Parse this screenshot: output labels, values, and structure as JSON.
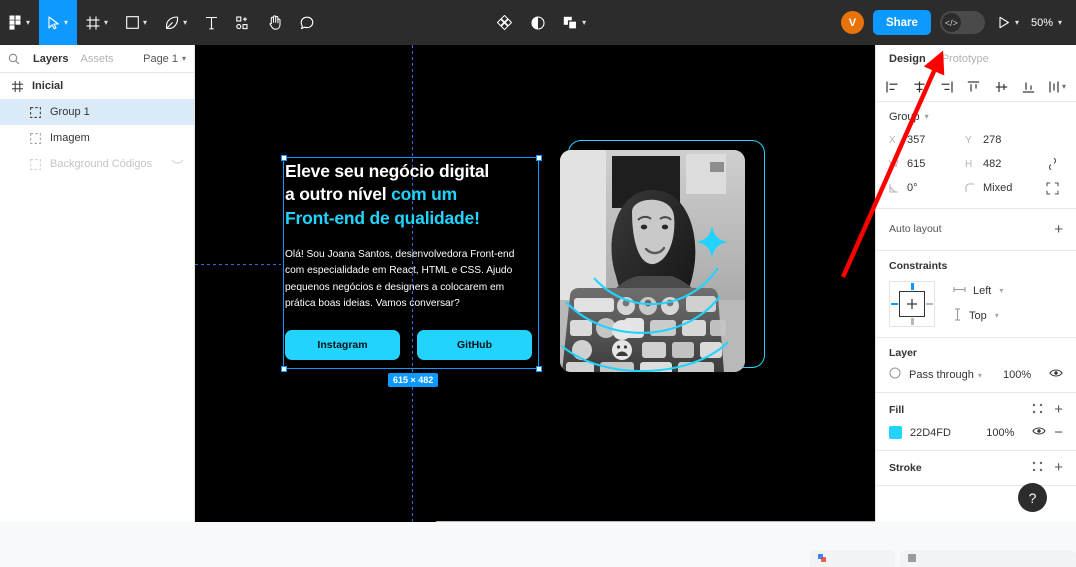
{
  "toolbar": {
    "menu_icon": "figma-logo-icon",
    "move_tool": "move-cursor-icon",
    "frame_tool": "frame-icon",
    "shape_tool": "rectangle-icon",
    "pen_tool": "pen-icon",
    "text_tool": "text-icon",
    "components_tool": "components-plus-icon",
    "hand_tool": "hand-icon",
    "comment_tool": "comment-bubble-icon",
    "plugin_icon": "plugin-diamond-icon",
    "contrast_icon": "contrast-half-circle-icon",
    "boolean_icon": "boolean-union-icon",
    "avatar_initial": "V",
    "share_label": "Share",
    "dev_mode_icon": "code-slash-icon",
    "present_icon": "play-triangle-icon",
    "zoom_level": "50%"
  },
  "left_panel": {
    "search_icon": "search-icon",
    "tabs": [
      {
        "label": "Layers",
        "active": true
      },
      {
        "label": "Assets",
        "active": false
      }
    ],
    "page_selector": "Page 1",
    "layers": [
      {
        "name": "Inicial",
        "icon": "frame-icon",
        "depth": 0,
        "selected": false,
        "dimmed": false,
        "hidden": false
      },
      {
        "name": "Group 1",
        "icon": "group-icon",
        "depth": 1,
        "selected": true,
        "dimmed": false,
        "hidden": false
      },
      {
        "name": "Imagem",
        "icon": "group-icon",
        "depth": 1,
        "selected": false,
        "dimmed": false,
        "hidden": false
      },
      {
        "name": "Background Códigos",
        "icon": "group-icon",
        "depth": 1,
        "selected": false,
        "dimmed": true,
        "hidden": true
      }
    ]
  },
  "canvas": {
    "background_color": "#000000",
    "accent_color": "#22D4FD",
    "selection_color": "#0D99FF",
    "size_badge": "615 × 482",
    "design": {
      "heading_line1": "Eleve seu negócio digital",
      "heading_line2_plain": "a outro nível ",
      "heading_line2_accent": "com um",
      "heading_line3_accent": "Front-end de qualidade!",
      "body": "Olá! Sou Joana Santos, desenvolvedora Front-end com especialidade em React, HTML e CSS. Ajudo pequenos negócios e designers a colocarem em prática boas ideias. Vamos conversar?",
      "buttons": [
        {
          "label": "Instagram"
        },
        {
          "label": "GitHub"
        }
      ],
      "photo_alt": "black-and-white photo of a woman smiling at a sticker-covered laptop"
    }
  },
  "right_panel": {
    "tabs": [
      {
        "label": "Design",
        "active": true
      },
      {
        "label": "Prototype",
        "active": false
      }
    ],
    "align_icons": [
      "align-left-icon",
      "align-horizontal-center-icon",
      "align-right-icon",
      "align-top-icon",
      "align-vertical-center-icon",
      "align-bottom-icon",
      "distribute-icon"
    ],
    "group_section": {
      "title": "Group",
      "x_label": "X",
      "x_value": "357",
      "y_label": "Y",
      "y_value": "278",
      "w_label": "W",
      "w_value": "615",
      "h_label": "H",
      "h_value": "482",
      "rotation_value": "0°",
      "corner_radius_value": "Mixed",
      "proportion_icon": "link-ratio-icon",
      "independent_corners_icon": "corner-radius-icon"
    },
    "auto_layout": {
      "label": "Auto layout",
      "add_icon": "plus-icon"
    },
    "constraints": {
      "title": "Constraints",
      "horizontal": "Left",
      "vertical": "Top",
      "horizontal_icon": "horizontal-constraint-icon",
      "vertical_icon": "vertical-constraint-icon"
    },
    "layer": {
      "title": "Layer",
      "blend_mode": "Pass through",
      "opacity": "100%",
      "visibility_icon": "eye-icon",
      "blend_icon": "blend-mode-icon"
    },
    "fill": {
      "title": "Fill",
      "color_hex": "22D4FD",
      "color_value": "#22D4FD",
      "opacity": "100%",
      "style_icon": "style-grid-icon",
      "add_icon": "plus-icon",
      "visibility_icon": "eye-icon",
      "remove_icon": "minus-icon"
    },
    "stroke": {
      "title": "Stroke",
      "style_icon": "style-grid-icon",
      "add_icon": "plus-icon"
    },
    "help_button": "?"
  }
}
